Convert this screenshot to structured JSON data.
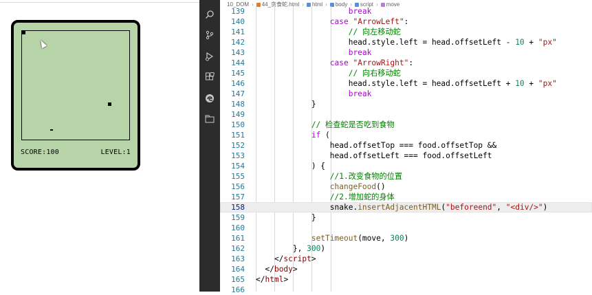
{
  "game": {
    "score_label": "SCORE:100",
    "level_label": "LEVEL:1"
  },
  "breadcrumb": {
    "items": [
      "10_DOM",
      "44_贪食蛇.html",
      "html",
      "body",
      "script",
      "move"
    ]
  },
  "activity_icons": [
    "search-icon",
    "source-control-icon",
    "run-debug-icon",
    "extensions-icon",
    "edge-icon",
    "folder-icon"
  ],
  "code": {
    "current_line": 158,
    "lines": [
      {
        "n": 139,
        "indent": 0,
        "tokens": [
          [
            "kw",
            "                    break"
          ]
        ]
      },
      {
        "n": 140,
        "tokens": [
          [
            "",
            "                "
          ],
          [
            "kw",
            "case"
          ],
          [
            "",
            " "
          ],
          [
            "str",
            "\"ArrowLeft\""
          ],
          [
            "",
            ":"
          ]
        ]
      },
      {
        "n": 141,
        "tokens": [
          [
            "cm",
            "                    // 向左移动蛇"
          ]
        ]
      },
      {
        "n": 142,
        "tokens": [
          [
            "",
            "                    head.style.left = head.offsetLeft - "
          ],
          [
            "num",
            "10"
          ],
          [
            "",
            " + "
          ],
          [
            "str",
            "\"px\""
          ]
        ]
      },
      {
        "n": 143,
        "tokens": [
          [
            "kw",
            "                    break"
          ]
        ]
      },
      {
        "n": 144,
        "tokens": [
          [
            "",
            "                "
          ],
          [
            "kw",
            "case"
          ],
          [
            "",
            " "
          ],
          [
            "str",
            "\"ArrowRight\""
          ],
          [
            "",
            ":"
          ]
        ]
      },
      {
        "n": 145,
        "tokens": [
          [
            "cm",
            "                    // 向右移动蛇"
          ]
        ]
      },
      {
        "n": 146,
        "tokens": [
          [
            "",
            "                    head.style.left = head.offsetLeft + "
          ],
          [
            "num",
            "10"
          ],
          [
            "",
            " + "
          ],
          [
            "str",
            "\"px\""
          ]
        ]
      },
      {
        "n": 147,
        "tokens": [
          [
            "kw",
            "                    break"
          ]
        ]
      },
      {
        "n": 148,
        "tokens": [
          [
            "",
            "            }"
          ]
        ]
      },
      {
        "n": 149,
        "tokens": [
          [
            "",
            ""
          ]
        ]
      },
      {
        "n": 150,
        "tokens": [
          [
            "cm",
            "            // 检查蛇是否吃到食物"
          ]
        ]
      },
      {
        "n": 151,
        "tokens": [
          [
            "",
            "            "
          ],
          [
            "kw",
            "if"
          ],
          [
            "",
            " ("
          ]
        ]
      },
      {
        "n": 152,
        "tokens": [
          [
            "",
            "                head.offsetTop === food.offsetTop &&"
          ]
        ]
      },
      {
        "n": 153,
        "tokens": [
          [
            "",
            "                head.offsetLeft === food.offsetLeft"
          ]
        ]
      },
      {
        "n": 154,
        "tokens": [
          [
            "",
            "            ) {"
          ]
        ]
      },
      {
        "n": 155,
        "tokens": [
          [
            "cm",
            "                //1.改变食物的位置"
          ]
        ]
      },
      {
        "n": 156,
        "tokens": [
          [
            "",
            "                "
          ],
          [
            "fn",
            "changeFood"
          ],
          [
            "",
            "()"
          ]
        ]
      },
      {
        "n": 157,
        "tokens": [
          [
            "cm",
            "                //2.增加蛇的身体"
          ]
        ]
      },
      {
        "n": 158,
        "tokens": [
          [
            "",
            "                snake."
          ],
          [
            "fn",
            "insertAdjacentHTML"
          ],
          [
            "",
            "("
          ],
          [
            "str",
            "\"beforeend\""
          ],
          [
            "",
            ", "
          ],
          [
            "str",
            "\"<div/>\""
          ],
          [
            "",
            ")"
          ]
        ]
      },
      {
        "n": 159,
        "tokens": [
          [
            "",
            "            }"
          ]
        ]
      },
      {
        "n": 160,
        "tokens": [
          [
            "",
            ""
          ]
        ]
      },
      {
        "n": 161,
        "tokens": [
          [
            "",
            "            "
          ],
          [
            "fn",
            "setTimeout"
          ],
          [
            "",
            "(move, "
          ],
          [
            "num",
            "300"
          ],
          [
            "",
            ")"
          ]
        ]
      },
      {
        "n": 162,
        "tokens": [
          [
            "",
            "        }, "
          ],
          [
            "num",
            "300"
          ],
          [
            "",
            ")"
          ]
        ]
      },
      {
        "n": 163,
        "tokens": [
          [
            "",
            "    </"
          ],
          [
            "tag",
            "script"
          ],
          [
            "",
            ">"
          ]
        ]
      },
      {
        "n": 164,
        "tokens": [
          [
            "",
            "  </"
          ],
          [
            "tag",
            "body"
          ],
          [
            "",
            ">"
          ]
        ]
      },
      {
        "n": 165,
        "tokens": [
          [
            "",
            "</"
          ],
          [
            "tag",
            "html"
          ],
          [
            "",
            ">"
          ]
        ]
      },
      {
        "n": 166,
        "tokens": [
          [
            "",
            ""
          ]
        ]
      }
    ]
  }
}
